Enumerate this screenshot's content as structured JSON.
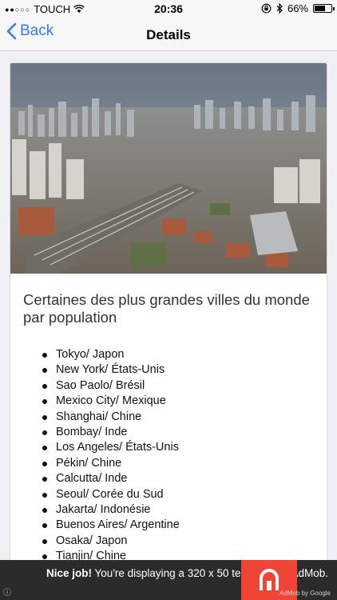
{
  "status_bar": {
    "carrier": "TOUCH",
    "time": "20:36",
    "battery": "66%",
    "battery_level": 0.66
  },
  "nav": {
    "back_label": "Back",
    "title": "Details"
  },
  "content": {
    "image_name": "city-aerial-photo",
    "title": "Certaines des plus grandes villes du monde par population",
    "cities": [
      "Tokyo/ Japon",
      "New York/ États-Unis",
      "Sao Paolo/ Brésil",
      "Mexico City/ Mexique",
      "Shanghai/ Chine",
      "Bombay/ Inde",
      "Los Angeles/ États-Unis",
      "Pékin/ Chine",
      "Calcutta/ Inde",
      "Seoul/ Corée du Sud",
      "Jakarta/ Indonésie",
      "Buenos Aires/ Argentine",
      "Osaka/ Japon",
      "Tianjin/ Chine"
    ]
  },
  "ad": {
    "headline": "Nice job!",
    "body": "You're displaying a 320 x 50 test ad from AdMob.",
    "footer": "AdMob by Google"
  },
  "colors": {
    "accent": "#2f7cf6",
    "ad_background": "#2b2b2b",
    "ad_logo": "#f04437"
  }
}
